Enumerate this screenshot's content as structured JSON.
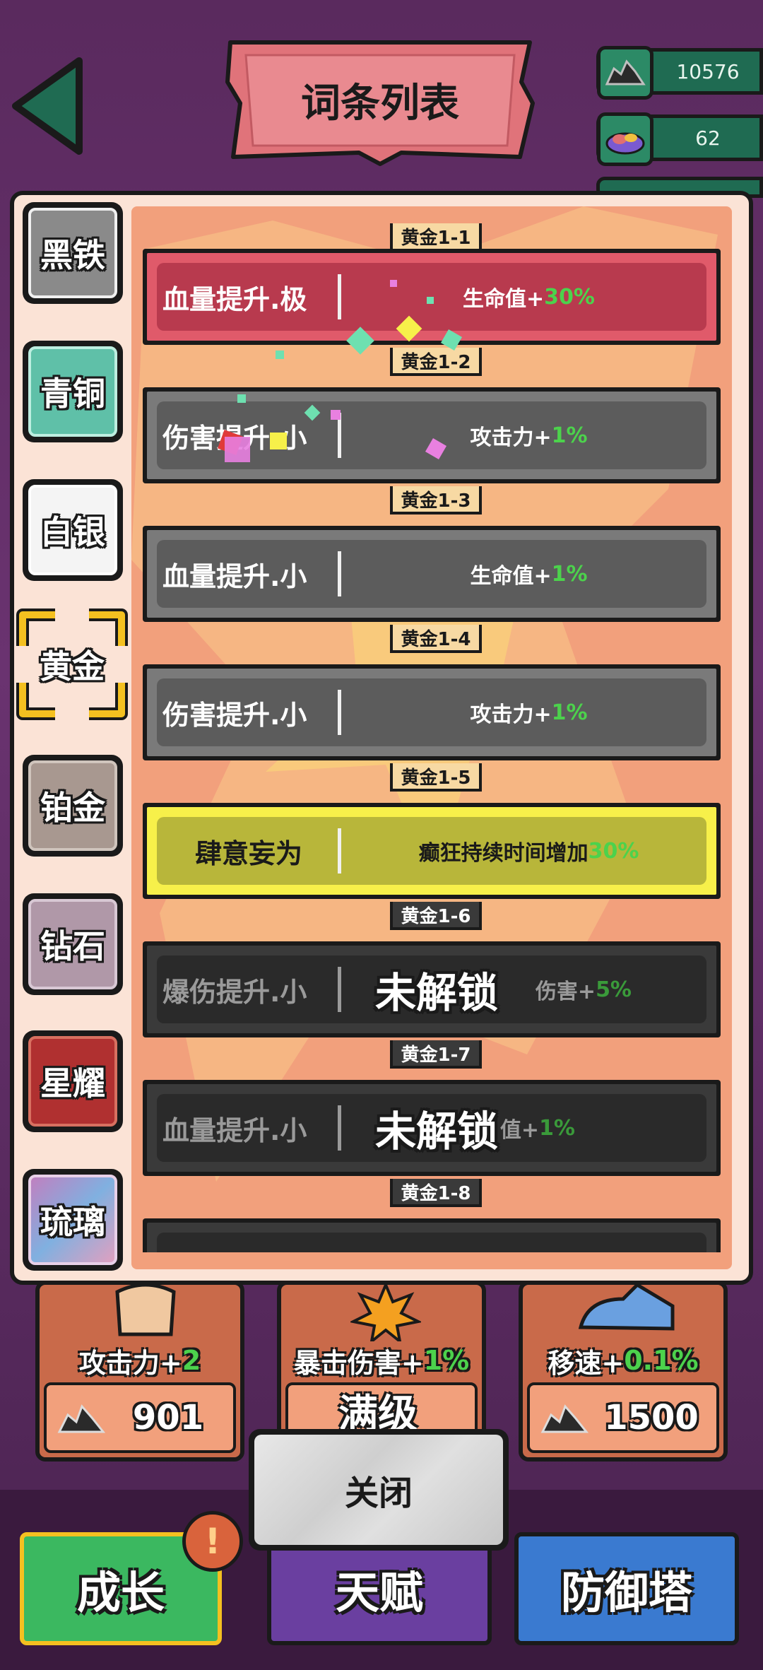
{
  "header": {
    "title": "词条列表",
    "resources": [
      {
        "icon": "ore-pile-icon",
        "value": "10576"
      },
      {
        "icon": "gem-pile-icon",
        "value": "62"
      }
    ]
  },
  "tiers": [
    {
      "label": "黑铁",
      "color": "#8a8a8a",
      "selected": false
    },
    {
      "label": "青铜",
      "color": "#5fc0a8",
      "selected": false
    },
    {
      "label": "白银",
      "color": "#e8e8e8",
      "selected": false
    },
    {
      "label": "黄金",
      "color": "#f4c020",
      "selected": true
    },
    {
      "label": "铂金",
      "color": "#a89890",
      "selected": false
    },
    {
      "label": "钻石",
      "color": "#b098a8",
      "selected": false
    },
    {
      "label": "星耀",
      "color": "#b03030",
      "selected": false
    },
    {
      "label": "琉璃",
      "color": "#c080c0",
      "selected": false
    }
  ],
  "affixes": [
    {
      "tag": "黄金1-1",
      "name": "血量提升.极",
      "effect_text": "生命值+",
      "effect_value": "30%",
      "style": "red",
      "locked": false
    },
    {
      "tag": "黄金1-2",
      "name": "伤害提升.小",
      "effect_text": "攻击力+",
      "effect_value": "1%",
      "style": "gray",
      "locked": false
    },
    {
      "tag": "黄金1-3",
      "name": "血量提升.小",
      "effect_text": "生命值+",
      "effect_value": "1%",
      "style": "gray",
      "locked": false
    },
    {
      "tag": "黄金1-4",
      "name": "伤害提升.小",
      "effect_text": "攻击力+",
      "effect_value": "1%",
      "style": "gray",
      "locked": false
    },
    {
      "tag": "黄金1-5",
      "name": "肆意妄为",
      "effect_text": "癫狂持续时间增加",
      "effect_value": "30%",
      "style": "yellow",
      "locked": false
    },
    {
      "tag": "黄金1-6",
      "name": "爆伤提升.小",
      "effect_text": "伤害+",
      "effect_value": "5%",
      "style": "dark",
      "locked": true
    },
    {
      "tag": "黄金1-7",
      "name": "血量提升.小",
      "effect_text": "值+",
      "effect_value": "1%",
      "style": "dark",
      "locked": true
    },
    {
      "tag": "黄金1-8",
      "name": "",
      "effect_text": "",
      "effect_value": "",
      "style": "dark",
      "locked": true
    }
  ],
  "lock_label": "未解锁",
  "shop": [
    {
      "label": "攻击力+",
      "value": "2",
      "price": "901",
      "icon": "fist-icon"
    },
    {
      "label": "暴击伤害+",
      "value": "1%",
      "price": "",
      "icon": "explosion-icon",
      "overlay": "满级"
    },
    {
      "label": "移速+",
      "value": "0.1%",
      "price": "1500",
      "icon": "sneaker-icon"
    }
  ],
  "close_label": "关闭",
  "nav": [
    {
      "label": "成长",
      "color": "#3bb860"
    },
    {
      "label": "天赋",
      "color": "#6a3fa0"
    },
    {
      "label": "防御塔",
      "color": "#3a7ad0"
    }
  ],
  "badge": "!",
  "colors": {
    "frame": "#1a1a1a",
    "modal_bg": "#fbe3d6",
    "content_bg": "#f2a07c",
    "accent_green": "#4cd24c",
    "gold": "#f4c020"
  }
}
